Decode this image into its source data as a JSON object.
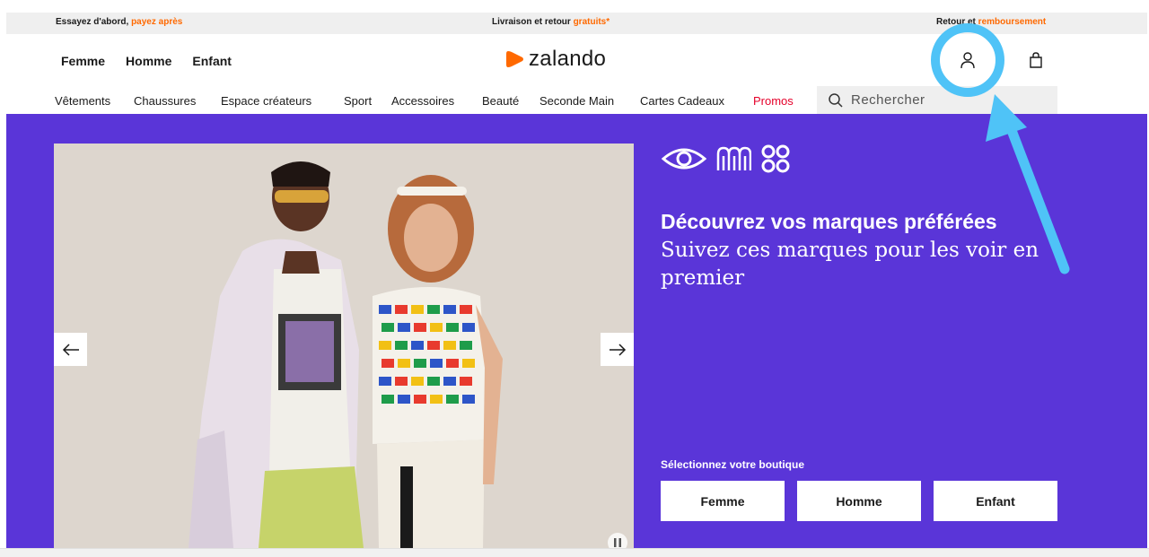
{
  "promo_bar": {
    "left_text": "Essayez d'abord, ",
    "left_accent": "payez après",
    "center_text": "Livraison et retour ",
    "center_accent": "gratuits*",
    "right_text": "Retour et ",
    "right_accent": "remboursement"
  },
  "header": {
    "gender_nav": [
      "Femme",
      "Homme",
      "Enfant"
    ],
    "logo_text": "zalando",
    "brand_color": "#ff6900",
    "account_icon": "user-icon",
    "bag_icon": "shopping-bag-icon"
  },
  "category_nav": {
    "items": [
      "Vêtements",
      "Chaussures",
      "Espace créateurs",
      "Sport",
      "Accessoires",
      "Beauté",
      "Seconde Main",
      "Cartes Cadeaux",
      "Promos"
    ],
    "promo_color": "#e5002a",
    "search_placeholder": "Rechercher"
  },
  "hero": {
    "background_color": "#5a35d8",
    "title": "Découvrez vos marques préférées",
    "subtitle": "Suivez ces marques pour les voir en premier",
    "shop_label": "Sélectionnez votre boutique",
    "shop_buttons": [
      "Femme",
      "Homme",
      "Enfant"
    ],
    "prev_icon": "arrow-left-icon",
    "next_icon": "arrow-right-icon",
    "pause_icon": "pause-icon"
  },
  "annotation": {
    "color": "#4fc3f7",
    "target": "account-button"
  }
}
